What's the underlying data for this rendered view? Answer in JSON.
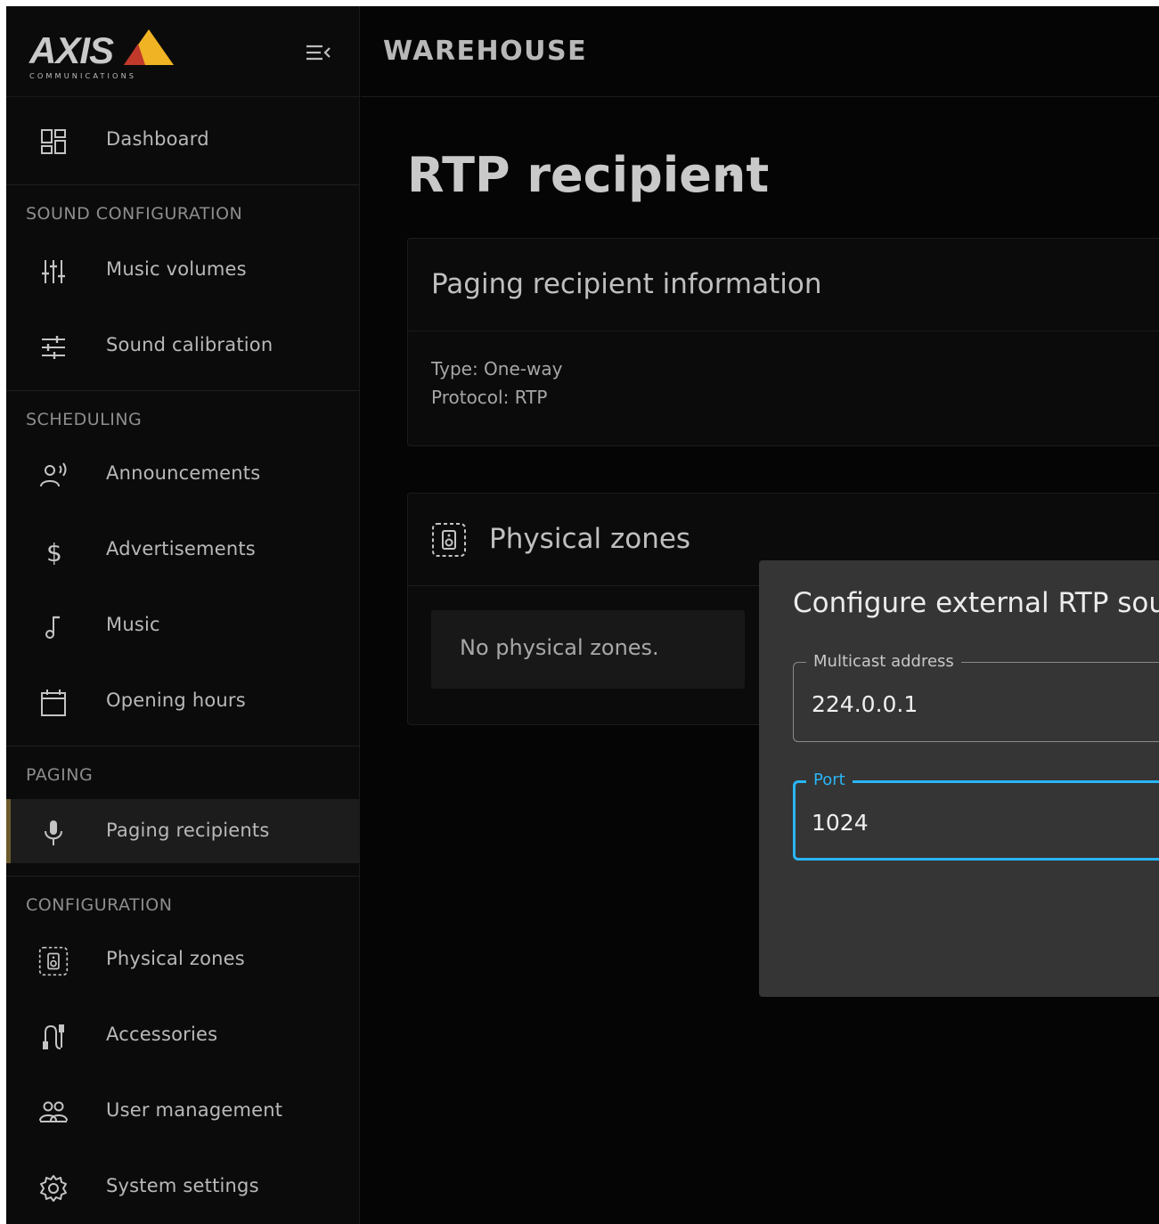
{
  "app": {
    "brand": "AXIS",
    "brand_sub": "COMMUNICATIONS",
    "site_title": "WAREHOUSE",
    "accent_color": "#f0b323",
    "focus_color": "#29b6f6"
  },
  "sidebar": {
    "collapse_icon": "collapse-menu-icon",
    "dashboard": {
      "label": "Dashboard",
      "icon": "dashboard-icon"
    },
    "sections": {
      "sound": "SOUND CONFIGURATION",
      "scheduling": "SCHEDULING",
      "paging": "PAGING",
      "configuration": "CONFIGURATION"
    },
    "items": {
      "music_volumes": {
        "label": "Music volumes",
        "icon": "equalizer-icon"
      },
      "sound_calibration": {
        "label": "Sound calibration",
        "icon": "sliders-icon"
      },
      "announcements": {
        "label": "Announcements",
        "icon": "announcement-icon"
      },
      "advertisements": {
        "label": "Advertisements",
        "icon": "dollar-icon"
      },
      "music": {
        "label": "Music",
        "icon": "music-note-icon"
      },
      "opening_hours": {
        "label": "Opening hours",
        "icon": "calendar-icon"
      },
      "paging_recipients": {
        "label": "Paging recipients",
        "icon": "microphone-icon",
        "active": true
      },
      "physical_zones": {
        "label": "Physical zones",
        "icon": "speaker-zone-icon"
      },
      "accessories": {
        "label": "Accessories",
        "icon": "accessories-icon"
      },
      "user_management": {
        "label": "User management",
        "icon": "users-icon"
      },
      "system_settings": {
        "label": "System settings",
        "icon": "gear-icon"
      }
    }
  },
  "main": {
    "page_title": "RTP recipient",
    "more_icon": "more-horizontal-icon",
    "info_card": {
      "title": "Paging recipient information",
      "type_line": "Type: One-way",
      "protocol_line": "Protocol: RTP"
    },
    "zones_card": {
      "title": "Physical zones",
      "icon": "speaker-zone-icon",
      "empty_text": "No physical zones."
    }
  },
  "dialog": {
    "title": "Configure external RTP sour",
    "multicast": {
      "label": "Multicast address",
      "value": "224.0.0.1"
    },
    "port": {
      "label": "Port",
      "value": "1024"
    }
  }
}
